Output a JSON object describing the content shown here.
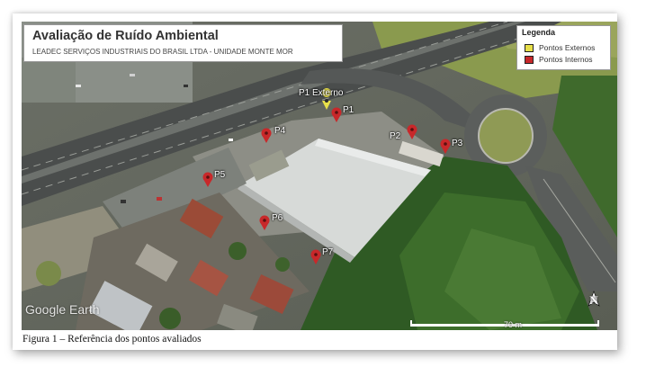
{
  "map": {
    "title": "Avaliação de Ruído Ambiental",
    "subtitle": "LEADEC SERVIÇOS INDUSTRIAIS DO BRASIL LTDA - UNIDADE MONTE MOR",
    "attribution": "Google Earth",
    "scale_label": "70 m",
    "north_label": "N"
  },
  "legend": {
    "title": "Legenda",
    "items": [
      {
        "label": "Pontos Externos",
        "color": "#e8e04a"
      },
      {
        "label": "Pontos Internos",
        "color": "#c8282a"
      }
    ]
  },
  "points": [
    {
      "id": "p1-externo",
      "label": "P1 Externo",
      "type": "externo"
    },
    {
      "id": "p1",
      "label": "P1",
      "type": "interno"
    },
    {
      "id": "p2",
      "label": "P2",
      "type": "interno"
    },
    {
      "id": "p3",
      "label": "P3",
      "type": "interno"
    },
    {
      "id": "p4",
      "label": "P4",
      "type": "interno"
    },
    {
      "id": "p5",
      "label": "P5",
      "type": "interno"
    },
    {
      "id": "p6",
      "label": "P6",
      "type": "interno"
    },
    {
      "id": "p7",
      "label": "P7",
      "type": "interno"
    }
  ],
  "caption": "Figura 1 – Referência dos pontos avaliados"
}
